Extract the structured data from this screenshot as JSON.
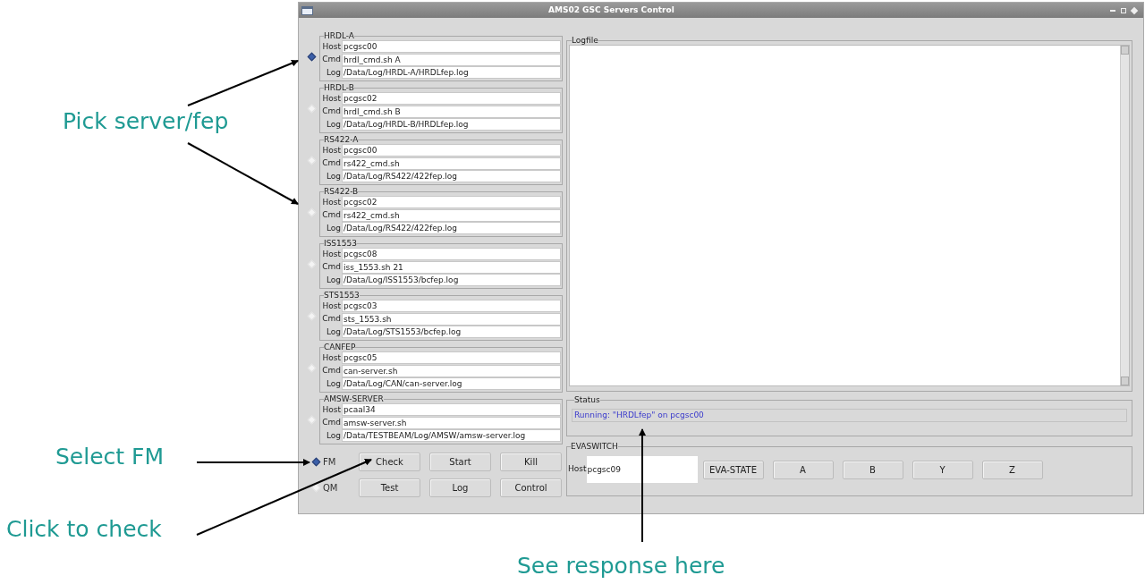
{
  "window": {
    "title": "AMS02 GSC Servers Control"
  },
  "servers": [
    {
      "name": "HRDL-A",
      "selected": true,
      "fields": [
        {
          "label": "Host",
          "value": "pcgsc00"
        },
        {
          "label": "Cmd",
          "value": "hrdl_cmd.sh A"
        },
        {
          "label": "Log",
          "value": "/Data/Log/HRDL-A/HRDLfep.log"
        }
      ]
    },
    {
      "name": "HRDL-B",
      "selected": false,
      "fields": [
        {
          "label": "Host",
          "value": "pcgsc02"
        },
        {
          "label": "Cmd",
          "value": "hrdl_cmd.sh B"
        },
        {
          "label": "Log",
          "value": "/Data/Log/HRDL-B/HRDLfep.log"
        }
      ]
    },
    {
      "name": "RS422-A",
      "selected": false,
      "fields": [
        {
          "label": "Host",
          "value": "pcgsc00"
        },
        {
          "label": "Cmd",
          "value": "rs422_cmd.sh"
        },
        {
          "label": "Log",
          "value": "/Data/Log/RS422/422fep.log"
        }
      ]
    },
    {
      "name": "RS422-B",
      "selected": false,
      "fields": [
        {
          "label": "Host",
          "value": "pcgsc02"
        },
        {
          "label": "Cmd",
          "value": "rs422_cmd.sh"
        },
        {
          "label": "Log",
          "value": "/Data/Log/RS422/422fep.log"
        }
      ]
    },
    {
      "name": "ISS1553",
      "selected": false,
      "fields": [
        {
          "label": "Host",
          "value": "pcgsc08"
        },
        {
          "label": "Cmd",
          "value": "iss_1553.sh 21"
        },
        {
          "label": "Log",
          "value": "/Data/Log/ISS1553/bcfep.log"
        }
      ]
    },
    {
      "name": "STS1553",
      "selected": false,
      "fields": [
        {
          "label": "Host",
          "value": "pcgsc03"
        },
        {
          "label": "Cmd",
          "value": "sts_1553.sh"
        },
        {
          "label": "Log",
          "value": "/Data/Log/STS1553/bcfep.log"
        }
      ]
    },
    {
      "name": "CANFEP",
      "selected": false,
      "fields": [
        {
          "label": "Host",
          "value": "pcgsc05"
        },
        {
          "label": "Cmd",
          "value": "can-server.sh"
        },
        {
          "label": "Log",
          "value": "/Data/Log/CAN/can-server.log"
        }
      ]
    },
    {
      "name": "AMSW-SERVER",
      "selected": false,
      "fields": [
        {
          "label": "Host",
          "value": "pcaal34"
        },
        {
          "label": "Cmd",
          "value": "amsw-server.sh"
        },
        {
          "label": "Log",
          "value": "/Data/TESTBEAM/Log/AMSW/amsw-server.log"
        }
      ]
    }
  ],
  "models": [
    {
      "label": "FM",
      "selected": true
    },
    {
      "label": "QM",
      "selected": false
    }
  ],
  "button_rows": [
    [
      "Check",
      "Start",
      "Kill"
    ],
    [
      "Test",
      "Log",
      "Control"
    ]
  ],
  "logfile": {
    "title": "Logfile"
  },
  "status": {
    "title": "Status",
    "text": "Running: \"HRDLfep\" on pcgsc00"
  },
  "evaswitch": {
    "title": "EVASWITCH",
    "host_label": "Host",
    "host_value": "pcgsc09",
    "buttons": [
      "EVA-STATE",
      "A",
      "B",
      "Y",
      "Z"
    ]
  },
  "annotations": [
    "Pick server/fep",
    "Select FM",
    "Click to check",
    "See response here"
  ]
}
